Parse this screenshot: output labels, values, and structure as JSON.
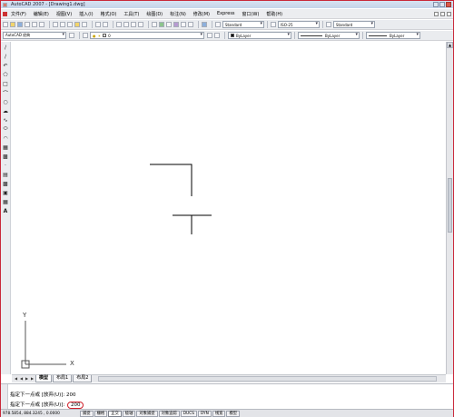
{
  "window": {
    "title": "AutoCAD 2007 - [Drawing1.dwg]"
  },
  "menu": [
    "文件(F)",
    "编辑(E)",
    "视图(V)",
    "插入(I)",
    "格式(O)",
    "工具(T)",
    "绘图(D)",
    "标注(N)",
    "修改(M)",
    "Express",
    "窗口(W)",
    "帮助(H)"
  ],
  "toolbar1": {
    "text_style": "Standard",
    "dim_style": "ISO-25",
    "table_style": "Standard"
  },
  "toolbar2": {
    "workspace": "AutoCAD 经典",
    "layer": "0",
    "color": "ByLayer",
    "linetype": "ByLayer",
    "lineweight": "ByLayer"
  },
  "canvas": {
    "ucs_y": "Y",
    "ucs_x": "X"
  },
  "tabs": [
    "模型",
    "布局1",
    "布局2"
  ],
  "command": {
    "line1_prompt": "指定下一点或 [放弃(U)]:",
    "line1_value": "200",
    "line2_prompt": "指定下一点或 [放弃(U)]:",
    "line2_value": "200"
  },
  "status": {
    "coordinates": "978.5854, 884.3245 , 0.0000",
    "buttons": [
      "捕捉",
      "栅格",
      "正交",
      "极轴",
      "对象捕捉",
      "对象追踪",
      "DUCS",
      "DYN",
      "线宽",
      "模型"
    ]
  },
  "colors": {
    "frame_border": "#c9283a",
    "highlight_circle": "#d0202a",
    "canvas_background": "#ffffff"
  }
}
